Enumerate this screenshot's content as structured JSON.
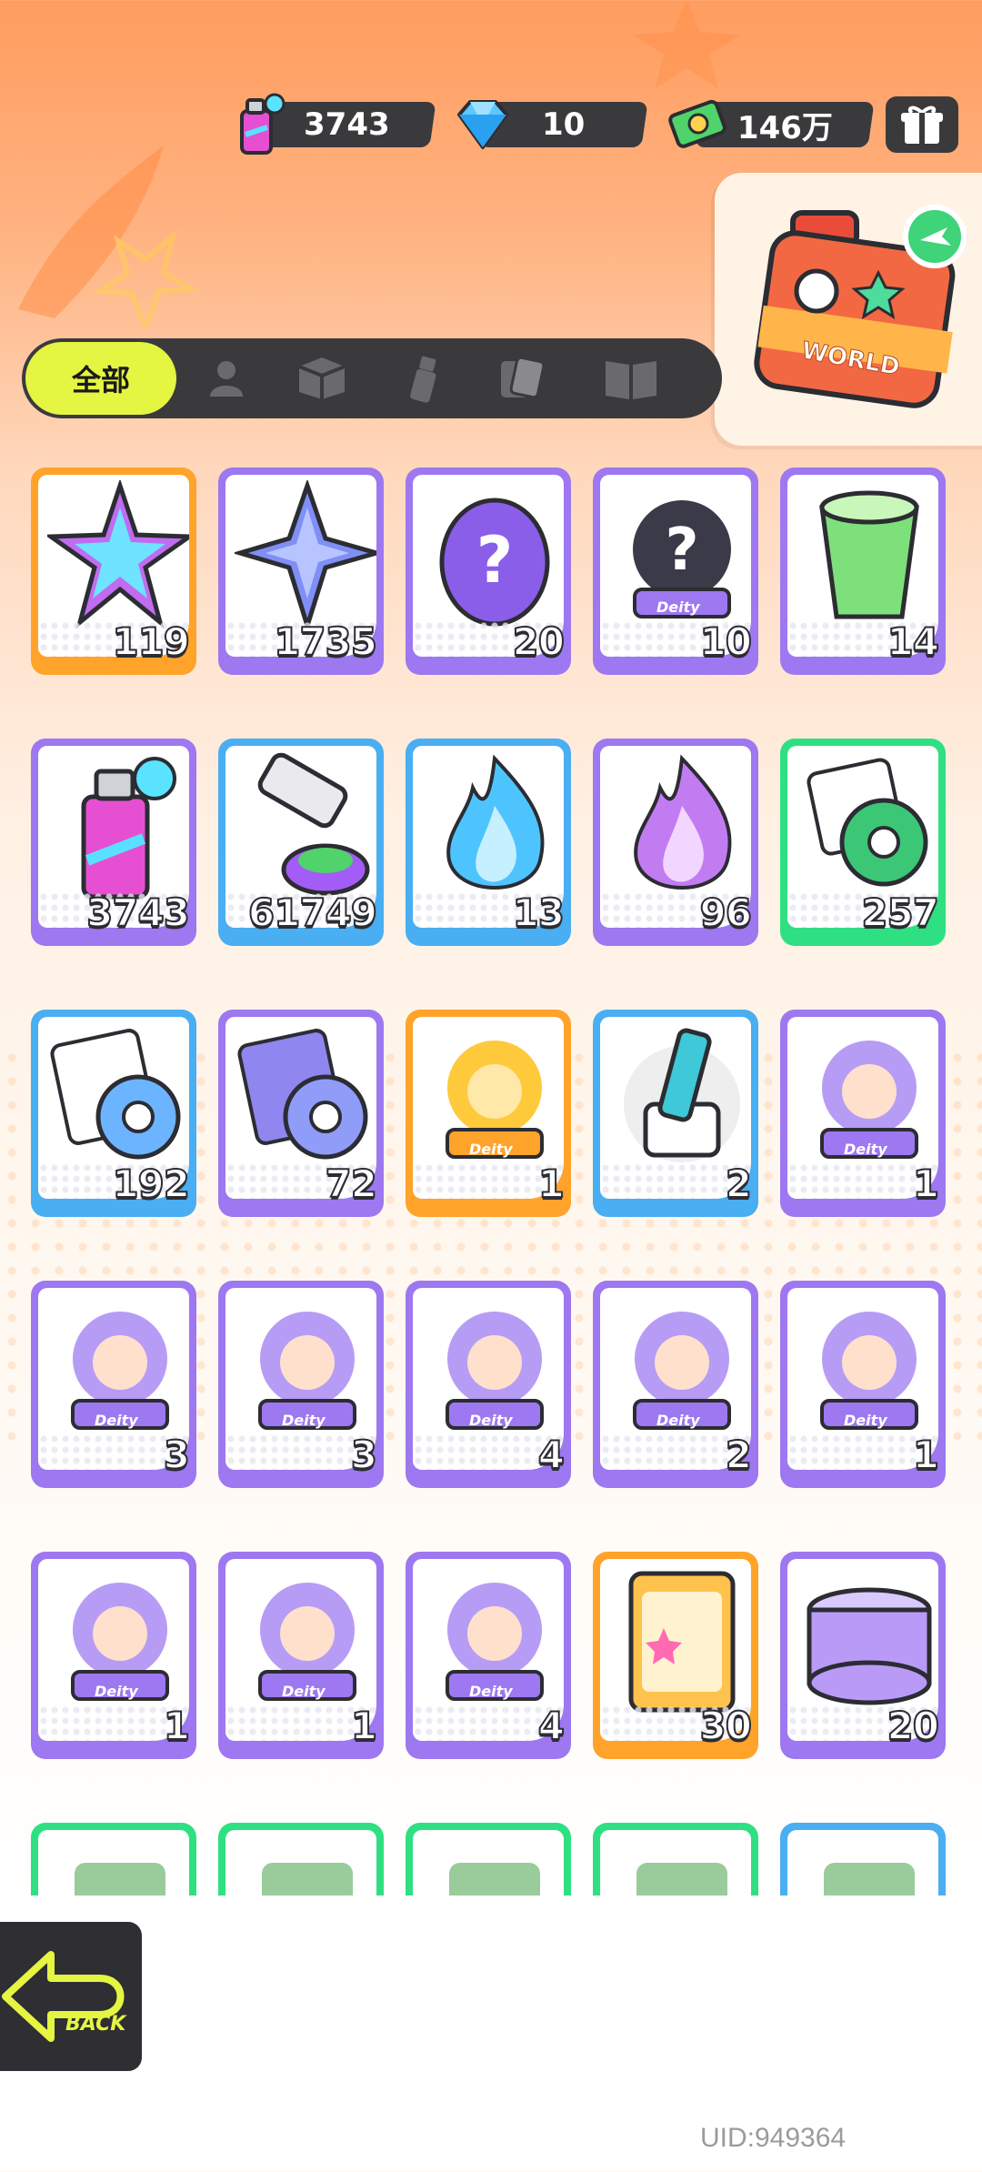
{
  "currencies": [
    {
      "name": "spray-can",
      "icon": "spray-can-icon",
      "value": "3743"
    },
    {
      "name": "diamond",
      "icon": "diamond-icon",
      "value": "10"
    },
    {
      "name": "cash",
      "icon": "cash-icon",
      "value": "146万"
    }
  ],
  "world_box": {
    "label": "WORLD"
  },
  "tabs": [
    {
      "label": "全部",
      "icon": "all",
      "active": true
    },
    {
      "label": "",
      "icon": "person-icon"
    },
    {
      "label": "",
      "icon": "box-icon"
    },
    {
      "label": "",
      "icon": "spray-icon"
    },
    {
      "label": "",
      "icon": "cards-icon"
    },
    {
      "label": "",
      "icon": "book-icon"
    }
  ],
  "items": [
    {
      "icon": "rainbow-star-icon",
      "qty": "119",
      "rarity": "orange"
    },
    {
      "icon": "blue-star-icon",
      "qty": "1735",
      "rarity": "purple"
    },
    {
      "icon": "mystery-egg-icon",
      "qty": "20",
      "rarity": "purple"
    },
    {
      "icon": "mystery-deity-icon",
      "qty": "10",
      "rarity": "purple"
    },
    {
      "icon": "drink-cup-icon",
      "qty": "14",
      "rarity": "purple"
    },
    {
      "icon": "spray-can-icon",
      "qty": "3743",
      "rarity": "purple"
    },
    {
      "icon": "paint-tube-icon",
      "qty": "61749",
      "rarity": "blue"
    },
    {
      "icon": "blue-flame-icon",
      "qty": "13",
      "rarity": "blue"
    },
    {
      "icon": "purple-flame-icon",
      "qty": "96",
      "rarity": "purple"
    },
    {
      "icon": "green-tape-icon",
      "qty": "257",
      "rarity": "green"
    },
    {
      "icon": "blue-tape-icon",
      "qty": "192",
      "rarity": "blue"
    },
    {
      "icon": "purple-tape-icon",
      "qty": "72",
      "rarity": "purple"
    },
    {
      "icon": "gold-deity-icon",
      "qty": "1",
      "rarity": "orange"
    },
    {
      "icon": "usb-key-icon",
      "qty": "2",
      "rarity": "blue"
    },
    {
      "icon": "deity-portrait-icon",
      "qty": "1",
      "rarity": "purple"
    },
    {
      "icon": "deity-portrait-icon",
      "qty": "3",
      "rarity": "purple"
    },
    {
      "icon": "deity-portrait-icon",
      "qty": "3",
      "rarity": "purple"
    },
    {
      "icon": "deity-portrait-icon",
      "qty": "4",
      "rarity": "purple"
    },
    {
      "icon": "deity-portrait-icon",
      "qty": "2",
      "rarity": "purple"
    },
    {
      "icon": "deity-portrait-icon",
      "qty": "1",
      "rarity": "purple"
    },
    {
      "icon": "deity-portrait-icon",
      "qty": "1",
      "rarity": "purple"
    },
    {
      "icon": "deity-portrait-icon",
      "qty": "1",
      "rarity": "purple"
    },
    {
      "icon": "deity-portrait-icon",
      "qty": "4",
      "rarity": "purple"
    },
    {
      "icon": "sticker-pack-icon",
      "qty": "30",
      "rarity": "orange"
    },
    {
      "icon": "cool-can-icon",
      "qty": "20",
      "rarity": "purple"
    },
    {
      "icon": "partial-item-icon",
      "qty": "",
      "rarity": "green"
    },
    {
      "icon": "partial-item-icon",
      "qty": "",
      "rarity": "green"
    },
    {
      "icon": "partial-item-icon",
      "qty": "",
      "rarity": "green"
    },
    {
      "icon": "partial-item-icon",
      "qty": "",
      "rarity": "green"
    },
    {
      "icon": "partial-item-icon",
      "qty": "",
      "rarity": "blue"
    }
  ],
  "deity_tag": "Deity",
  "back_button": {
    "label": "BACK"
  },
  "uid": "UID:949364",
  "colors": {
    "orange": "#ffa32a",
    "purple": "#9d78f0",
    "blue": "#49aef2",
    "green": "#2fe082",
    "active_tab": "#e4f542"
  }
}
